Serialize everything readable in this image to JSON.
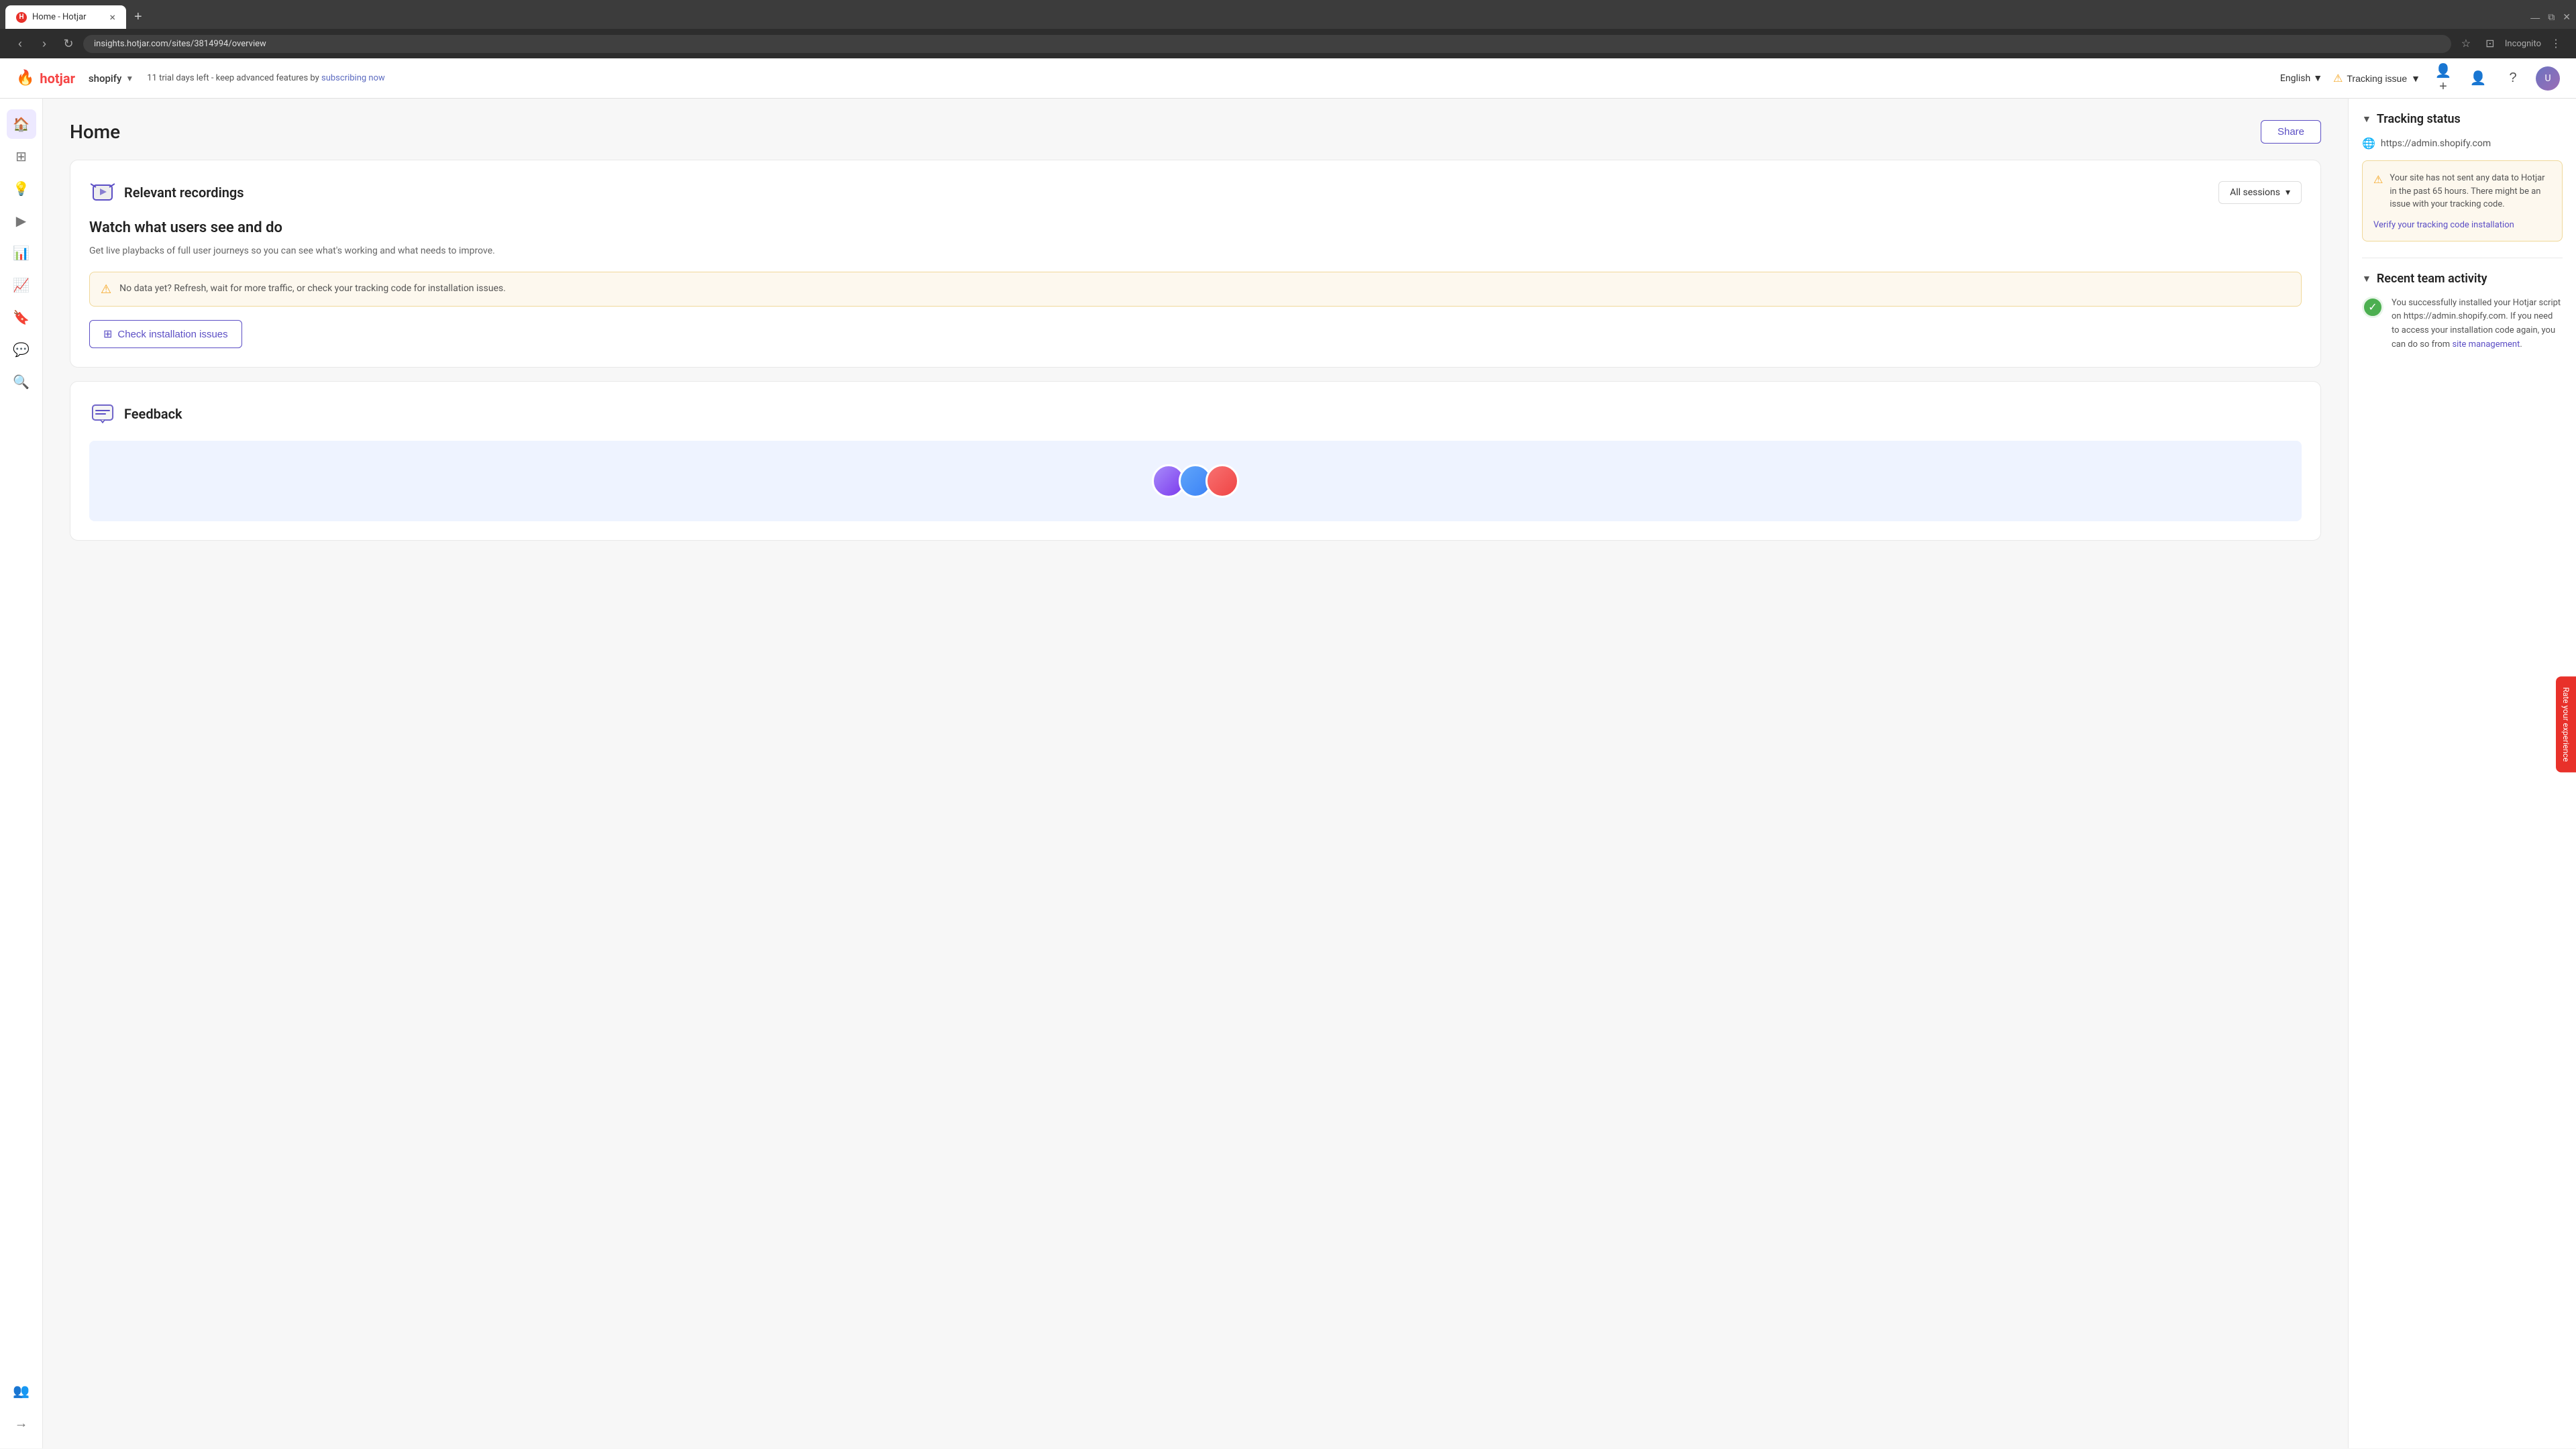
{
  "browser": {
    "tab_title": "Home - Hotjar",
    "tab_favicon": "H",
    "url": "insights.hotjar.com/sites/3814994/overview",
    "incognito_label": "Incognito"
  },
  "header": {
    "logo_text": "hotjar",
    "site_selector": "shopify",
    "trial_notice": "11 trial days left - keep advanced features by ",
    "trial_link_text": "subscribing now",
    "language": "English",
    "tracking_issue_label": "Tracking issue"
  },
  "sidebar": {
    "items": [
      {
        "id": "home",
        "icon": "⌂",
        "active": true
      },
      {
        "id": "dashboard",
        "icon": "⊞",
        "active": false
      },
      {
        "id": "insights",
        "icon": "💡",
        "active": false
      },
      {
        "id": "recordings",
        "icon": "📊",
        "active": false
      },
      {
        "id": "analytics",
        "icon": "📈",
        "active": false
      },
      {
        "id": "funnels",
        "icon": "🔖",
        "active": false
      },
      {
        "id": "surveys",
        "icon": "🔍",
        "active": false
      },
      {
        "id": "feedback",
        "icon": "💬",
        "active": false
      },
      {
        "id": "observe",
        "icon": "👁",
        "active": false
      }
    ],
    "bottom_items": [
      {
        "id": "team",
        "icon": "👥"
      },
      {
        "id": "collapse",
        "icon": "→"
      }
    ]
  },
  "main": {
    "page_title": "Home",
    "share_btn": "Share",
    "recordings_card": {
      "title": "Relevant recordings",
      "dropdown_label": "All sessions",
      "section_title": "Watch what users see and do",
      "section_subtitle": "Get live playbacks of full user journeys so you can see what's working and what needs to improve.",
      "warning_text": "No data yet? Refresh, wait for more traffic, or check your tracking code for installation issues.",
      "check_btn": "Check installation issues"
    },
    "feedback_card": {
      "title": "Feedback"
    }
  },
  "right_panel": {
    "tracking_status": {
      "title": "Tracking status",
      "site_url": "https://admin.shopify.com",
      "warning_text": "Your site has not sent any data to Hotjar in the past 65 hours. There might be an issue with your tracking code.",
      "verify_link": "Verify your tracking code installation"
    },
    "recent_activity": {
      "title": "Recent team activity",
      "activity_text": "You successfully installed your Hotjar script on https://admin.shopify.com. If you need to access your installation code again, you can do so from ",
      "activity_link_text": "site management",
      "activity_suffix": "."
    }
  },
  "rate_tab": {
    "label": "Rate your experience"
  }
}
